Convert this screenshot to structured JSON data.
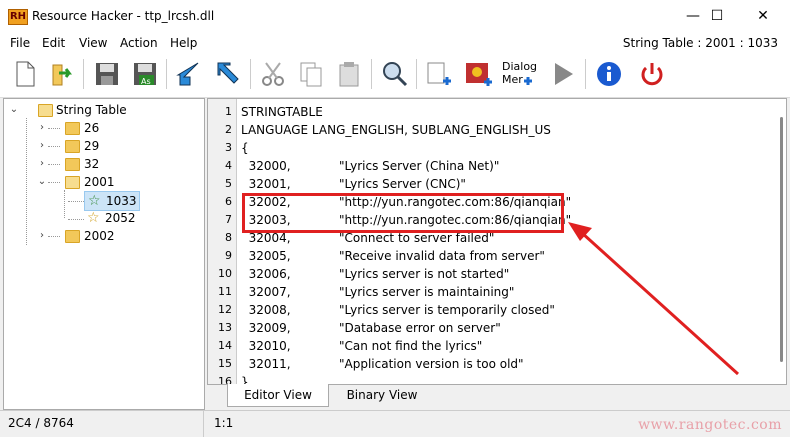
{
  "window": {
    "app_logo": "RH",
    "title": "Resource Hacker - ttp_lrcsh.dll",
    "controls": {
      "minimize": "—",
      "maximize": "☐",
      "close": "✕"
    }
  },
  "menu": {
    "items": [
      "File",
      "Edit",
      "View",
      "Action",
      "Help"
    ],
    "status": "String Table : 2001 : 1033"
  },
  "toolbar": {
    "dialog_label_line1": "Dialog",
    "dialog_label_line2": "Mer"
  },
  "tree": {
    "root": "String Table",
    "items": [
      {
        "label": "26"
      },
      {
        "label": "29"
      },
      {
        "label": "32"
      },
      {
        "label": "2001"
      },
      {
        "label": "1033"
      },
      {
        "label": "2052"
      },
      {
        "label": "2002"
      }
    ]
  },
  "editor": {
    "line_numbers": [
      "1",
      "2",
      "3",
      "4",
      "5",
      "6",
      "7",
      "8",
      "9",
      "10",
      "11",
      "12",
      "13",
      "14",
      "15",
      "16"
    ],
    "lines": [
      {
        "id": "",
        "text": "STRINGTABLE"
      },
      {
        "id": "",
        "text": "LANGUAGE LANG_ENGLISH, SUBLANG_ENGLISH_US"
      },
      {
        "id": "",
        "text": "{"
      },
      {
        "id": "  32000,",
        "text": "\"Lyrics Server (China Net)\""
      },
      {
        "id": "  32001,",
        "text": "\"Lyrics Server (CNC)\""
      },
      {
        "id": "  32002,",
        "text": "\"http://yun.rangotec.com:86/qianqian\""
      },
      {
        "id": "  32003,",
        "text": "\"http://yun.rangotec.com:86/qianqian\""
      },
      {
        "id": "  32004,",
        "text": "\"Connect to server failed\""
      },
      {
        "id": "  32005,",
        "text": "\"Receive invalid data from server\""
      },
      {
        "id": "  32006,",
        "text": "\"Lyrics server is not started\""
      },
      {
        "id": "  32007,",
        "text": "\"Lyrics server is maintaining\""
      },
      {
        "id": "  32008,",
        "text": "\"Lyrics server is temporarily closed\""
      },
      {
        "id": "  32009,",
        "text": "\"Database error on server\""
      },
      {
        "id": "  32010,",
        "text": "\"Can not find the lyrics\""
      },
      {
        "id": "  32011,",
        "text": "\"Application version is too old\""
      },
      {
        "id": "",
        "text": "}"
      }
    ]
  },
  "tabs": {
    "editor": "Editor View",
    "binary": "Binary View"
  },
  "status": {
    "position": "2C4 / 8764",
    "cursor": "1:1"
  },
  "watermark": "www.rangotec.com",
  "colors": {
    "highlight": "#e02020",
    "selection": "#cce4f7",
    "folder": "#f2c85a"
  }
}
